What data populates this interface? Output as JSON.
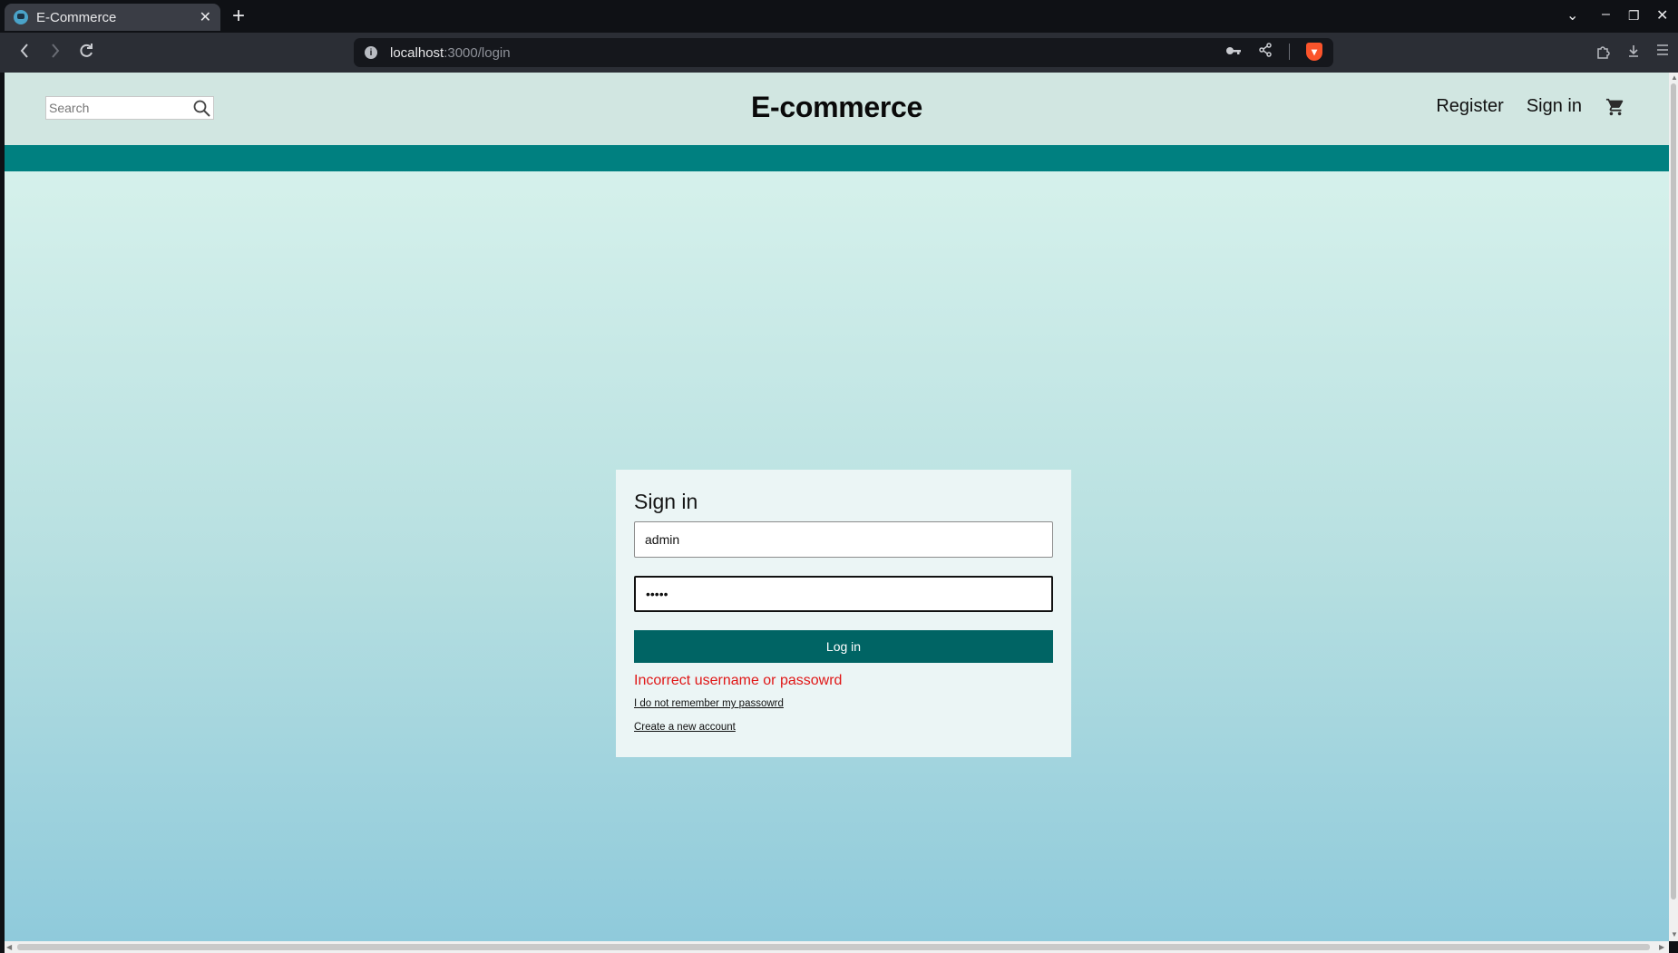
{
  "browser": {
    "tab_title": "E-Commerce",
    "tab_close": "✕",
    "new_tab": "+",
    "url_host": "localhost",
    "url_rest": ":3000/login",
    "window_controls": {
      "chevron": "⌄",
      "minimize": "–",
      "restore": "❐",
      "close": "✕"
    },
    "icons": [
      "back-icon",
      "forward-icon",
      "reload-icon",
      "site-info-icon",
      "key-icon",
      "share-icon",
      "brave-shield-icon",
      "extensions-icon",
      "download-icon",
      "menu-icon"
    ]
  },
  "header": {
    "search_placeholder": "Search",
    "brand": "E-commerce",
    "register_label": "Register",
    "signin_label": "Sign in"
  },
  "login": {
    "title": "Sign in",
    "username_value": "admin",
    "password_value": "•••••",
    "submit_label": "Log in",
    "error_message": "Incorrect username or passowrd",
    "forgot_link": "I do not remember my passowrd",
    "register_link": "Create a new account"
  },
  "colors": {
    "header_bg": "#d1e6e1",
    "band": "#008080",
    "button": "#006464",
    "error": "#e01717",
    "card_bg": "#ebf5f5"
  }
}
